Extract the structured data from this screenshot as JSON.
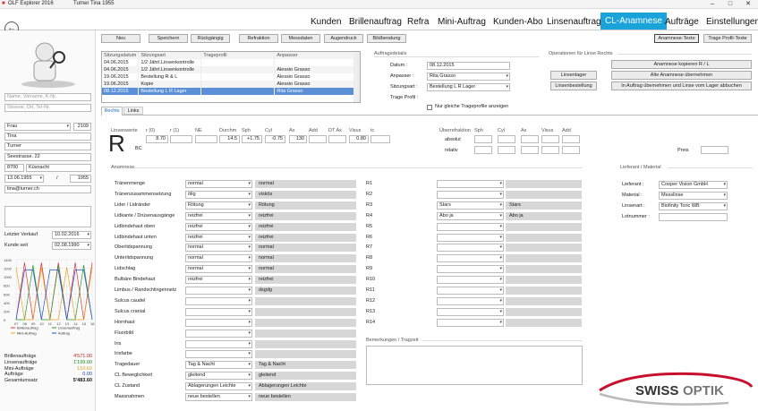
{
  "window": {
    "title": "OLF Explorer 2016",
    "user": "Turner  Tina  1955"
  },
  "nav": {
    "items": [
      "Kunden",
      "Brillenauftrag",
      "Refra",
      "Mini-Auftrag",
      "Kunden-Abo",
      "Linsenauftrag",
      "CL-Anamnese",
      "Aufträge",
      "Einstellungen"
    ],
    "active": "CL-Anamnese"
  },
  "customer": {
    "name_placeholder": "Name, Vorname, K-Nr.",
    "address_placeholder": "Strasse, Ort, Tel-Nr.",
    "salutation": "Frau",
    "number": "2109",
    "firstname": "Tina",
    "lastname": "Turner",
    "street": "Seestrasse. 22",
    "zip": "8700",
    "city": "Küsnacht",
    "birthdate": "13.06.1955",
    "year": "1955",
    "email": "tina@turner.ch",
    "last_sale_label": "Letzter Verkauf",
    "last_sale": "10.02.2016",
    "since_label": "Kunde seit",
    "since": "02.08.1990"
  },
  "minichart": {
    "yticks": [
      "1400",
      "1200",
      "1000",
      "800",
      "600",
      "400",
      "200",
      "0"
    ],
    "xticks": [
      "07",
      "08",
      "09",
      "10",
      "11",
      "12",
      "13",
      "14",
      "15",
      "16"
    ],
    "legend": [
      "Brillenauftrag",
      "Linsenauftrag",
      "Mini-Auftrag",
      "Auftrag"
    ],
    "colors": [
      "#e03030",
      "#2a9a2a",
      "#e8a020",
      "#2050d0"
    ]
  },
  "totals": [
    {
      "label": "Brillenaufträge",
      "value": "4'571.00",
      "color": "#c02020"
    },
    {
      "label": "Linsenaufträge",
      "value": "1'199.00",
      "color": "#1a8a1a"
    },
    {
      "label": "Mini-Aufträge",
      "value": "153.60",
      "color": "#e0a020"
    },
    {
      "label": "Aufträge",
      "value": "0.00",
      "color": "#2040c0"
    },
    {
      "label": "Gesamtumsatz",
      "value": "5'483.60",
      "color": "#111"
    }
  ],
  "toolbar": {
    "neu": "Neu",
    "speichern": "Speichern",
    "rueck": "Rückgängig",
    "refraktion": "Refraktion",
    "messdaten": "Messdaten",
    "augendruck": "Augendruck",
    "bildberatung": "Bildberatung",
    "anamnese_texte": "Anamnese-Texte",
    "trage_texte": "Trage Profil-Texte"
  },
  "sittings": {
    "headers": [
      "Sitzungsdatum",
      "Sitzungsart",
      "Trageprofil",
      "Anpasser"
    ],
    "rows": [
      [
        "04.06.2015",
        "1/2 Jährl.Linsenkontrolle",
        "",
        ""
      ],
      [
        "04.06.2015",
        "1/2 Jährl.Linsenkontrolle",
        "",
        "Alessio Grasso"
      ],
      [
        "19.06.2015",
        "Bestellung R & L",
        "",
        "Alessio Grasso"
      ],
      [
        "19.06.2015",
        "Kopie",
        "",
        "Alessio Grasso"
      ],
      [
        "08.12.2015",
        "Bestellung L R Lager",
        "",
        "Rita Grasso"
      ]
    ]
  },
  "order": {
    "title": "Auftragsdetails",
    "datum_label": "Datum :",
    "datum": "08.12.2015",
    "anpasser_label": "Anpasser :",
    "anpasser": "Rita Grasso",
    "art_label": "Sitzungsart :",
    "art": "Bestellung L R Lager",
    "profil_label": "Trage Profil :",
    "checkbox": "Nur gleiche Trageprofile anzeigen"
  },
  "ops": {
    "title": "Operationen für Linse Rechts",
    "linsenlager": "Linsenlager",
    "linsenbestellung": "Linsenbestellung",
    "copy": "Anamnese kopieren R / L",
    "take": "Alte Anamnese übernehmen",
    "abbuchen": "In Auftrag übernehmen und Linse vom Lager abbuchen"
  },
  "tabs": [
    "Rechts",
    "Links"
  ],
  "lens": {
    "title": "Linsenwerte",
    "labels": [
      "r (0)",
      "r (1)",
      "NE",
      "Durchm",
      "Sph",
      "Cyl",
      "Ax",
      "Add",
      "DT Ax",
      "Visus",
      "tc"
    ],
    "values": [
      "8.70",
      "",
      "",
      "14.5",
      "+1.75",
      "-0.75",
      "130",
      "",
      "",
      "0.80",
      ""
    ],
    "side": "R",
    "bc": "BC",
    "over_title": "Überrefraktion",
    "over_labels": [
      "Sph",
      "Cyl",
      "Ax",
      "Visus",
      "Add"
    ],
    "abs": "absolut",
    "rel": "relativ",
    "preis": "Preis"
  },
  "anamnese": {
    "title": "Anamnese",
    "rows": [
      {
        "l": "Tränenmenge",
        "v": "normal",
        "t": "normal"
      },
      {
        "l": "Tränenzusammensetzung",
        "v": "ölig",
        "t": "viskös"
      },
      {
        "l": "Lider /  Lidränder",
        "v": "Rötung",
        "t": "Rötung"
      },
      {
        "l": "Lidkante / Drüsenausgänge",
        "v": "reizfrei",
        "t": "reizfrei"
      },
      {
        "l": "Lidbindehaut oben",
        "v": "reizfrei",
        "t": "reizfrei"
      },
      {
        "l": "Lidbindehaut unten",
        "v": "reizfrei",
        "t": "reizfrei"
      },
      {
        "l": "Oberlidspannung",
        "v": "normal",
        "t": "normal"
      },
      {
        "l": "Unterlidspannung",
        "v": "normal",
        "t": "normal"
      },
      {
        "l": "Lidschlag",
        "v": "normal",
        "t": "normal"
      },
      {
        "l": "Bulbäre Bindehaut",
        "v": "reizfrei",
        "t": "reizfrei"
      },
      {
        "l": "Limbus / Randschlingennetz",
        "v": "",
        "t": "dsgdg"
      },
      {
        "l": "Sulcus caudel",
        "v": "",
        "t": ""
      },
      {
        "l": "Sulcus cranial",
        "v": "",
        "t": ""
      },
      {
        "l": "Hornhaut",
        "v": "",
        "t": ""
      },
      {
        "l": "Fluorbild",
        "v": "",
        "t": ""
      },
      {
        "l": "Iris",
        "v": "",
        "t": ""
      },
      {
        "l": "Irisfarbe",
        "v": "",
        "t": ""
      },
      {
        "l": "Tragedauer",
        "v": "Tag & Nacht",
        "t": "Tag & Nacht"
      },
      {
        "l": "CL Beweglichkeit",
        "v": "gleitend",
        "t": "gleitend"
      },
      {
        "l": "CL Zustand",
        "v": "Ablagerungen Leichte",
        "t": "Ablagerungen Leichte"
      },
      {
        "l": "Massnahmen",
        "v": "neue bestellen",
        "t": "neue bestellen"
      }
    ]
  },
  "r": {
    "rows": [
      {
        "l": "R1",
        "v": "",
        "t": ""
      },
      {
        "l": "R2",
        "v": "",
        "t": ""
      },
      {
        "l": "R3",
        "v": "Stars",
        "t": "Stars"
      },
      {
        "l": "R4",
        "v": "Abo ja",
        "t": "Abo ja"
      },
      {
        "l": "R5",
        "v": "",
        "t": ""
      },
      {
        "l": "R6",
        "v": "",
        "t": ""
      },
      {
        "l": "R7",
        "v": "",
        "t": ""
      },
      {
        "l": "R8",
        "v": "",
        "t": ""
      },
      {
        "l": "R9",
        "v": "",
        "t": ""
      },
      {
        "l": "R10",
        "v": "",
        "t": ""
      },
      {
        "l": "R11",
        "v": "",
        "t": ""
      },
      {
        "l": "R12",
        "v": "",
        "t": ""
      },
      {
        "l": "R13",
        "v": "",
        "t": ""
      },
      {
        "l": "R14",
        "v": "",
        "t": ""
      }
    ],
    "remarks": "Bemerkungen / Tragzeit"
  },
  "supplier": {
    "title": "Lieferant / Material",
    "lieferant_label": "Lieferant :",
    "lieferant": "Cooper Vision GmbH",
    "material_label": "Material :",
    "material": "Messlinse",
    "linse_label": "Linsenart :",
    "linse": "Biofinity Toric WB",
    "lotnr_label": "Lotnummer :",
    "lotnr": ""
  },
  "brand": {
    "a": "SWISS",
    "b": "OPTIK"
  }
}
